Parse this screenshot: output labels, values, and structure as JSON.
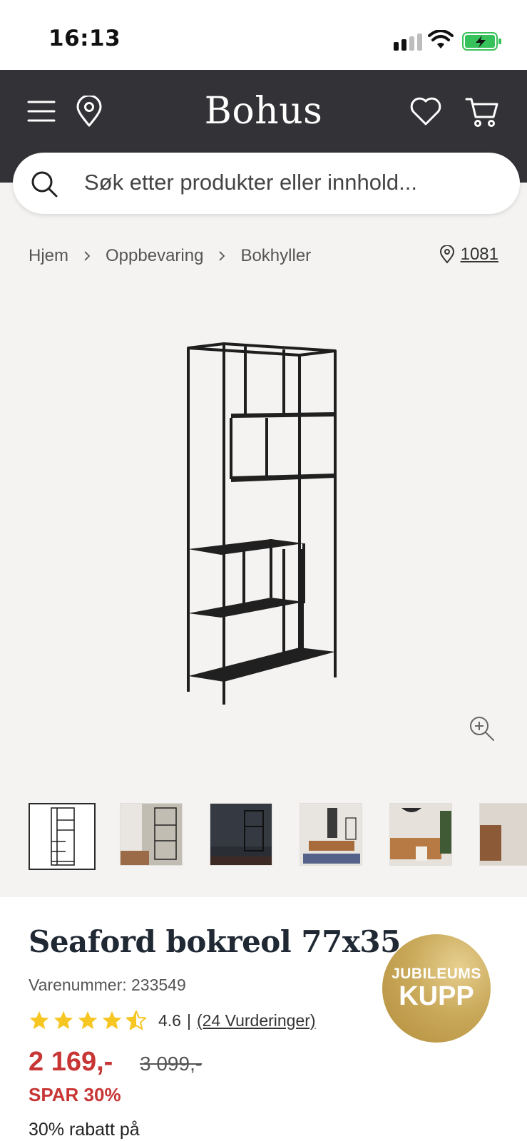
{
  "status_bar": {
    "time": "16:13"
  },
  "header": {
    "logo": "Bohus",
    "colors": {
      "background": "#333236",
      "foreground": "#ffffff"
    },
    "icons": [
      "menu-icon",
      "location-pin-icon",
      "heart-icon",
      "cart-icon"
    ]
  },
  "search": {
    "placeholder": "Søk etter produkter eller innhold..."
  },
  "breadcrumb": {
    "items": [
      "Hjem",
      "Oppbevaring",
      "Bokhyller"
    ],
    "store_code": "1081"
  },
  "gallery": {
    "thumbnails": [
      "thumb-1",
      "thumb-2",
      "thumb-3",
      "thumb-4",
      "thumb-5",
      "thumb-6"
    ],
    "active_index": 0
  },
  "product": {
    "title": "Seaford bokreol 77x35",
    "sku_label": "Varenummer: 233549",
    "rating": {
      "value": "4.6",
      "separator": "|",
      "reviews": "(24 Vurderinger)",
      "stars_out_of_5": 4.6
    },
    "price": "2 169,-",
    "old_price": "3 099,-",
    "save_label": "SPAR 30%",
    "promo_text": "30% rabatt på",
    "badge": {
      "line1": "JUBILEUMS",
      "line2": "KUPP"
    },
    "colors": {
      "sale": "#c83535",
      "star": "#f6c623",
      "badge_gold": "#c9a95a"
    }
  }
}
